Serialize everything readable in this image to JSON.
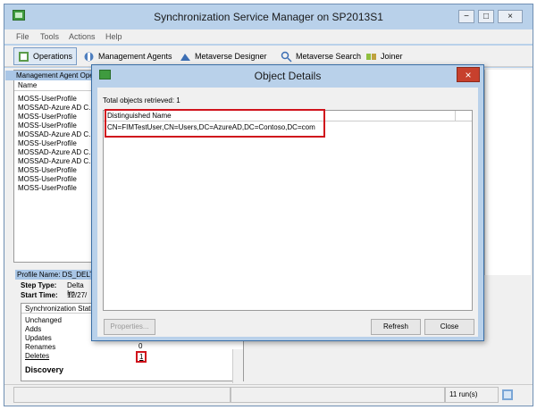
{
  "window": {
    "title": "Synchronization Service Manager on SP2013S1",
    "controls": {
      "minimize": "−",
      "maximize": "□",
      "close": "×"
    }
  },
  "menu": [
    "File",
    "Tools",
    "Actions",
    "Help"
  ],
  "toolbar": {
    "operations": "Operations",
    "management_agents": "Management Agents",
    "metaverse_designer": "Metaverse Designer",
    "metaverse_search": "Metaverse Search",
    "joiner": "Joiner"
  },
  "ma_pane": {
    "header": "Management Agent Ope",
    "column": "Name",
    "rows": [
      "MOSS-UserProfile",
      "MOSSAD-Azure AD C...",
      "MOSS-UserProfile",
      "MOSS-UserProfile",
      "MOSSAD-Azure AD C...",
      "MOSS-UserProfile",
      "MOSSAD-Azure AD C...",
      "MOSSAD-Azure AD C...",
      "MOSS-UserProfile",
      "MOSS-UserProfile",
      "MOSS-UserProfile"
    ]
  },
  "profile": {
    "name_label": "Profile Name: DS_DELT",
    "step_type_label": "Step Type:",
    "step_type_value": "Delta Im",
    "start_time_label": "Start Time:",
    "start_time_value": "12/27/"
  },
  "stats": {
    "header": "Synchronization Statisti",
    "rows": [
      "Unchanged",
      "Adds",
      "Updates",
      "Renames",
      "Deletes"
    ],
    "renames_value": "0",
    "deletes_value": "1",
    "section": "Discovery"
  },
  "statusbar": {
    "runs": "11 run(s)"
  },
  "dialog": {
    "title": "Object Details",
    "close": "×",
    "total": "Total objects retrieved: 1",
    "column": "Distinguished Name",
    "rows": [
      "CN=FIMTestUser,CN=Users,DC=AzureAD,DC=Contoso,DC=com"
    ],
    "properties_button": "Properties...",
    "refresh_button": "Refresh",
    "close_button": "Close"
  },
  "colors": {
    "highlight": "#d0131c",
    "titlebar": "#b9d1ea",
    "header_blue": "#a9c6e6"
  }
}
